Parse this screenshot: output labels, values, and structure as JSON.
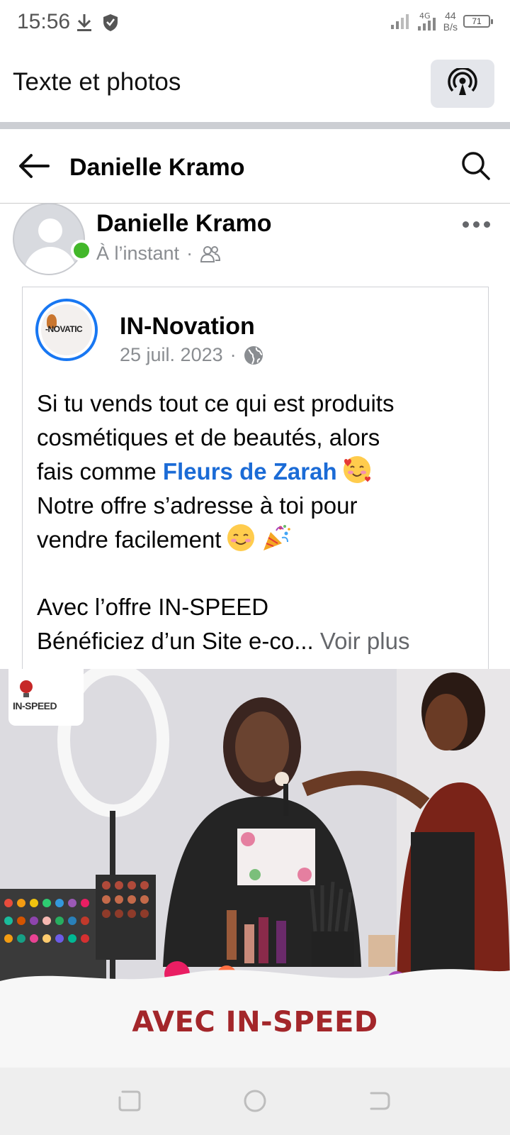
{
  "status_bar": {
    "time": "15:56",
    "network_type": "4G",
    "speed_value": "44",
    "speed_unit": "B/s",
    "battery": "71"
  },
  "app_header": {
    "title": "Texte et photos"
  },
  "profile_nav": {
    "title": "Danielle Kramo"
  },
  "post": {
    "author": "Danielle Kramo",
    "timestamp": "À l’instant",
    "separator": "·"
  },
  "shared_post": {
    "page_name": "IN-Novation",
    "logo_text": "-NOVATIC",
    "date": "25 juil. 2023",
    "separator": "·",
    "text": {
      "line1": "Si tu vends tout ce qui est produits",
      "line2": "cosmétiques et de beautés, alors",
      "line3_prefix": "fais comme ",
      "line3_link": "Fleurs de Zarah",
      "line4": "Notre offre s’adresse à toi pour",
      "line5": "vendre facilement",
      "line7": "Avec l’offre IN-SPEED",
      "line8": "Bénéficiez d’un Site e-co...",
      "see_more": "Voir plus"
    }
  },
  "image": {
    "logo_text": "IN-SPEED",
    "caption": "AVEC IN-SPEED"
  },
  "colors": {
    "link": "#1b6bd6",
    "online": "#42b72a",
    "meta": "#8a8d91",
    "caption": "#a3262a"
  }
}
